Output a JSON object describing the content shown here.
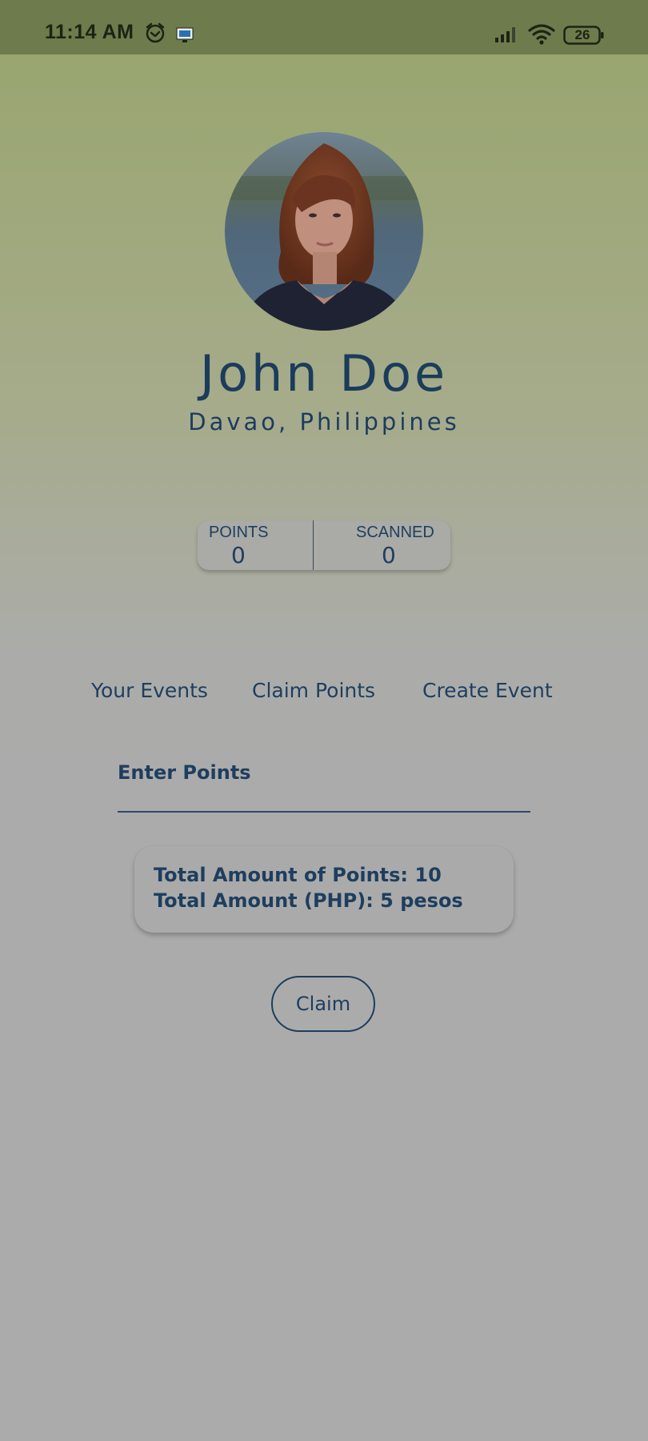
{
  "status_bar": {
    "time": "11:14 AM",
    "battery_level": "26",
    "icons": [
      "alarm-icon",
      "screen-mirror-icon",
      "signal-icon",
      "wifi-icon",
      "battery-icon"
    ]
  },
  "profile": {
    "name": "John Doe",
    "location": "Davao, Philippines",
    "avatar": "profile-photo"
  },
  "stats": {
    "points_label": "POINTS",
    "points_value": "0",
    "scanned_label": "SCANNED",
    "scanned_value": "0"
  },
  "tabs": [
    {
      "label": "Your Events"
    },
    {
      "label": "Claim Points"
    },
    {
      "label": "Create Event"
    }
  ],
  "claim_form": {
    "points_field_label": "Enter Points",
    "points_field_value": "",
    "total_points_line": "Total Amount of Points: 10",
    "total_php_line": "Total Amount (PHP): 5 pesos",
    "claim_button_label": "Claim"
  },
  "colors": {
    "text_primary": "#1e3e5e",
    "status_bar": "#6e7b4c",
    "background_top": "#97a56c",
    "background_bottom": "#ababab"
  }
}
